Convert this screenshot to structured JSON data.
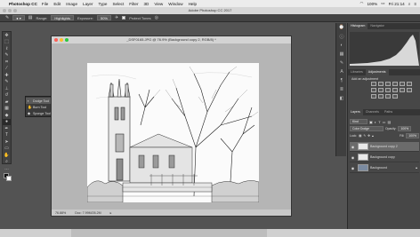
{
  "menubar": {
    "app": "Photoshop CC",
    "items": [
      "File",
      "Edit",
      "Image",
      "Layer",
      "Type",
      "Select",
      "Filter",
      "3D",
      "View",
      "Window",
      "Help"
    ],
    "battery": "100%",
    "time": "Fri 21:14"
  },
  "app_title": "Adobe Photoshop CC 2017",
  "options": {
    "range_label": "Range:",
    "range_value": "Highlights",
    "exposure_label": "Exposure:",
    "exposure_value": "50%",
    "protect_tones": "Protect Tones"
  },
  "flyout": {
    "items": [
      {
        "label": "Dodge Tool",
        "key": "O"
      },
      {
        "label": "Burn Tool",
        "key": "O"
      },
      {
        "label": "Sponge Tool",
        "key": "O"
      }
    ]
  },
  "document": {
    "title": "_DSF0165.JPG @ 76.9% (Background copy 2, RGB/8) *",
    "zoom": "76.88%",
    "doc_size": "Doc: 7.99M/26.2M"
  },
  "panels": {
    "histogram_tab": "Histogram",
    "navigator_tab": "Navigator",
    "libraries_tab": "Libraries",
    "adjustments_tab": "Adjustments",
    "add_adjustment": "Add an adjustment",
    "layers_tab": "Layers",
    "channels_tab": "Channels",
    "paths_tab": "Paths",
    "kind": "Kind",
    "blend_mode": "Color Dodge",
    "opacity_label": "Opacity:",
    "opacity_value": "100%",
    "lock_label": "Lock:",
    "fill_label": "Fill:",
    "fill_value": "100%",
    "layers": [
      {
        "name": "Background copy 2",
        "selected": true
      },
      {
        "name": "Background copy",
        "selected": false
      },
      {
        "name": "Background",
        "selected": false
      }
    ]
  },
  "colors": {
    "ui_dark": "#535353",
    "panel": "#474747",
    "close": "#fc5f57",
    "minimize": "#fdbc2e",
    "maximize": "#29c940"
  }
}
